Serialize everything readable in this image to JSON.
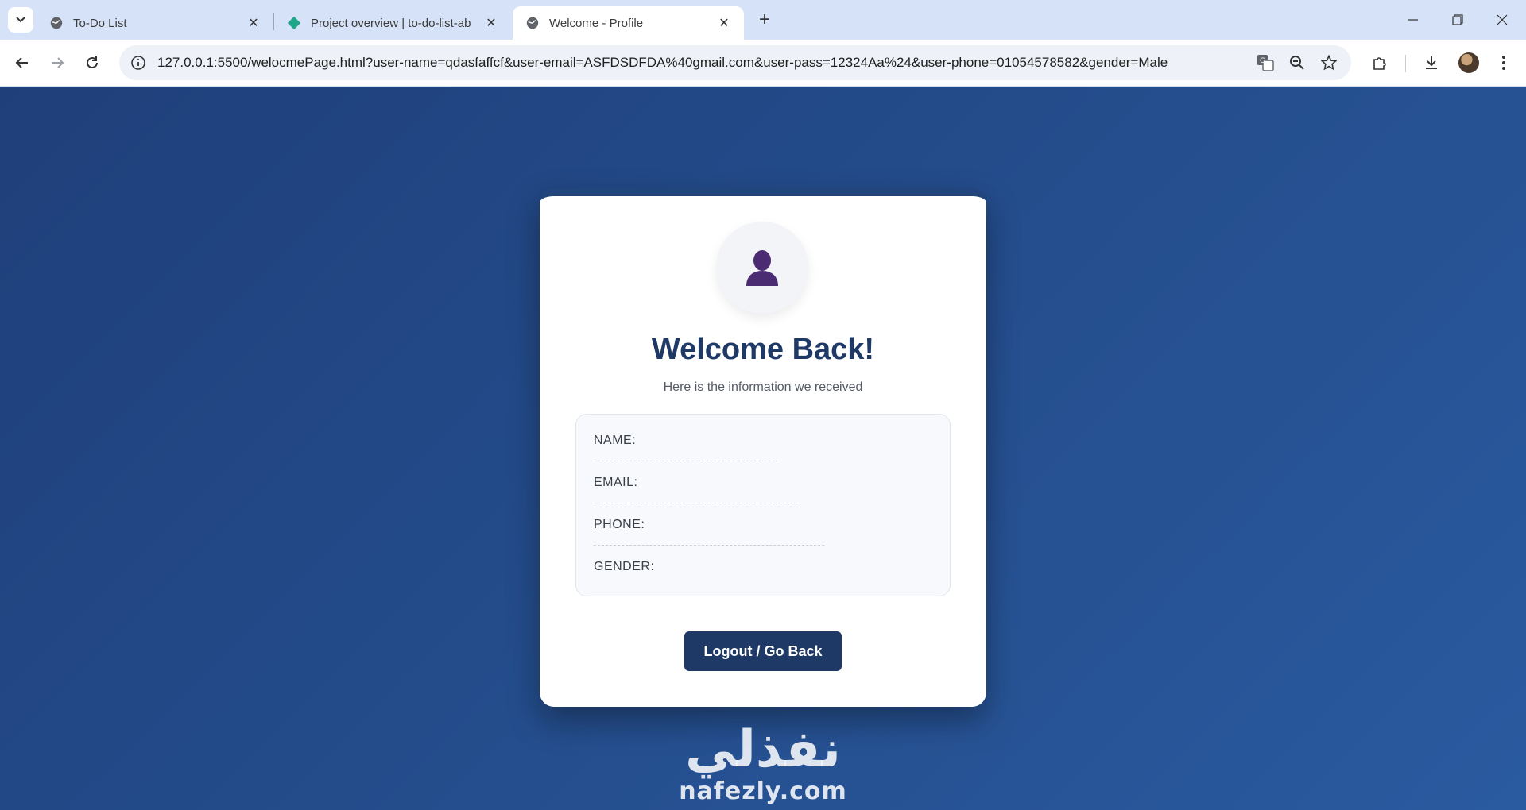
{
  "browser": {
    "tabs": [
      {
        "title": "To-Do List",
        "icon": "globe-icon",
        "active": false
      },
      {
        "title": "Project overview | to-do-list-ab",
        "icon": "diamond-icon",
        "active": false
      },
      {
        "title": "Welcome - Profile",
        "icon": "globe-icon",
        "active": true
      }
    ],
    "url": "127.0.0.1:5500/welocmePage.html?user-name=qdasfaffcf&user-email=ASFDSDFDA%40gmail.com&user-pass=12324Aa%24&user-phone=01054578582&gender=Male"
  },
  "page": {
    "title": "Welcome Back!",
    "subtitle": "Here is the information we received",
    "fields": {
      "name_label": "NAME:",
      "email_label": "EMAIL:",
      "phone_label": "PHONE:",
      "gender_label": "GENDER:"
    },
    "button_label": "Logout / Go Back",
    "colors": {
      "accent": "#1f3966",
      "background": "#244d8c",
      "avatar": "#4b2c73"
    }
  },
  "watermark": {
    "arabic": "نفذلي",
    "latin": "nafezly.com"
  }
}
